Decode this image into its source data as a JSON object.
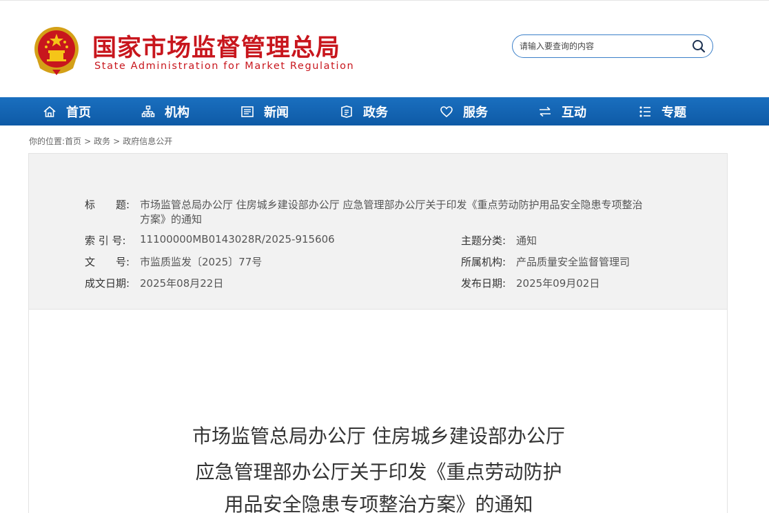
{
  "header": {
    "site_title": "国家市场监督管理总局",
    "site_subtitle": "State Administration for Market Regulation",
    "search_placeholder": "请输入要查询的内容",
    "brand_red": "#c8161d",
    "icons": {
      "emblem": "national-emblem",
      "search": "search-icon"
    }
  },
  "nav": {
    "bg_color": "#1565b5",
    "items": [
      {
        "label": "首页",
        "icon": "home-icon"
      },
      {
        "label": "机构",
        "icon": "org-icon"
      },
      {
        "label": "新闻",
        "icon": "news-icon"
      },
      {
        "label": "政务",
        "icon": "gov-icon"
      },
      {
        "label": "服务",
        "icon": "heart-icon"
      },
      {
        "label": "互动",
        "icon": "exchange-icon"
      },
      {
        "label": "专题",
        "icon": "list-icon"
      }
    ]
  },
  "breadcrumb": {
    "prefix": "你的位置:",
    "items": [
      "首页",
      "政务",
      "政府信息公开"
    ],
    "sep": ">"
  },
  "meta": {
    "title_label": "标　　题:",
    "title_value_line1": "市场监管总局办公厅 住房城乡建设部办公厅 应急管理部办公厅关于印发《重点劳动防护用品安全隐患专项整治",
    "title_value_line2": "方案》的通知",
    "index_label": "索 引 号:",
    "index_value": "11100000MB0143028R/2025-915606",
    "topic_label": "主题分类:",
    "topic_value": "通知",
    "doc_no_label": "文　　号:",
    "doc_no_value": "市监质监发〔2025〕77号",
    "org_label": "所属机构:",
    "org_value": "产品质量安全监督管理司",
    "created_label": "成文日期:",
    "created_value": "2025年08月22日",
    "published_label": "发布日期:",
    "published_value": "2025年09月02日"
  },
  "document": {
    "title_line1": "市场监管总局办公厅  住房城乡建设部办公厅",
    "title_line2": "应急管理部办公厅关于印发《重点劳动防护",
    "title_line3": "用品安全隐患专项整治方案》的通知"
  }
}
